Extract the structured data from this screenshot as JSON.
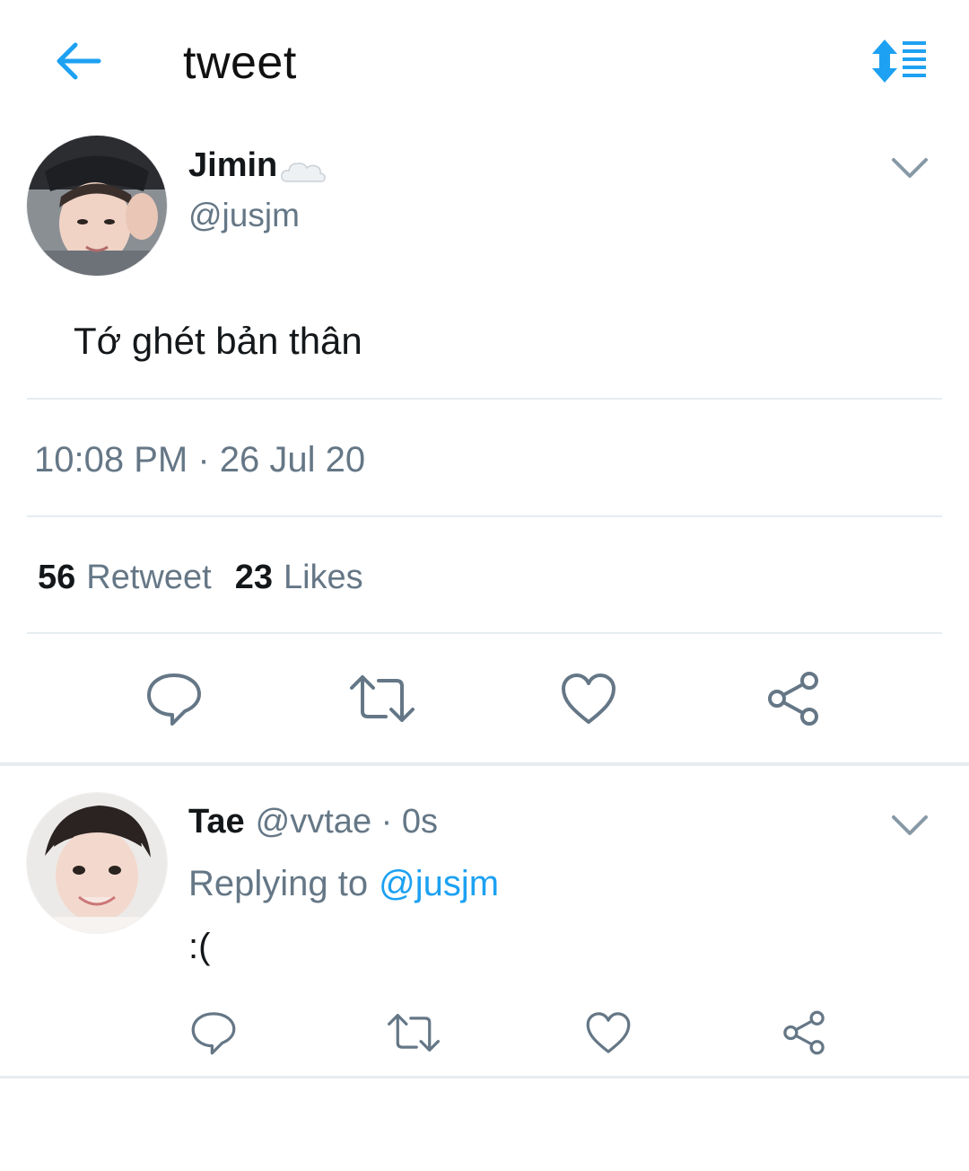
{
  "header": {
    "title": "tweet",
    "back_icon": "arrow-left-icon",
    "sort_icon": "sort-list-icon",
    "accent": "#1da1f2"
  },
  "tweet": {
    "author_name": "Jimin",
    "author_handle": "@jusjm",
    "name_emoji": "cloud-icon",
    "text": "Tớ ghét bản thân",
    "timestamp": "10:08 PM · 26 Jul 20",
    "retweet_count": "56",
    "retweet_label": "Retweet",
    "like_count": "23",
    "like_label": "Likes"
  },
  "reply": {
    "author_name": "Tae",
    "author_handle": "@vvtae · 0s",
    "replying_prefix": "Replying to",
    "replying_to": "@jusjm",
    "text": ":("
  },
  "colors": {
    "secondary_text": "#657786",
    "icon_gray": "#657786",
    "divider": "#e6ecf0",
    "link": "#1da1f2"
  }
}
